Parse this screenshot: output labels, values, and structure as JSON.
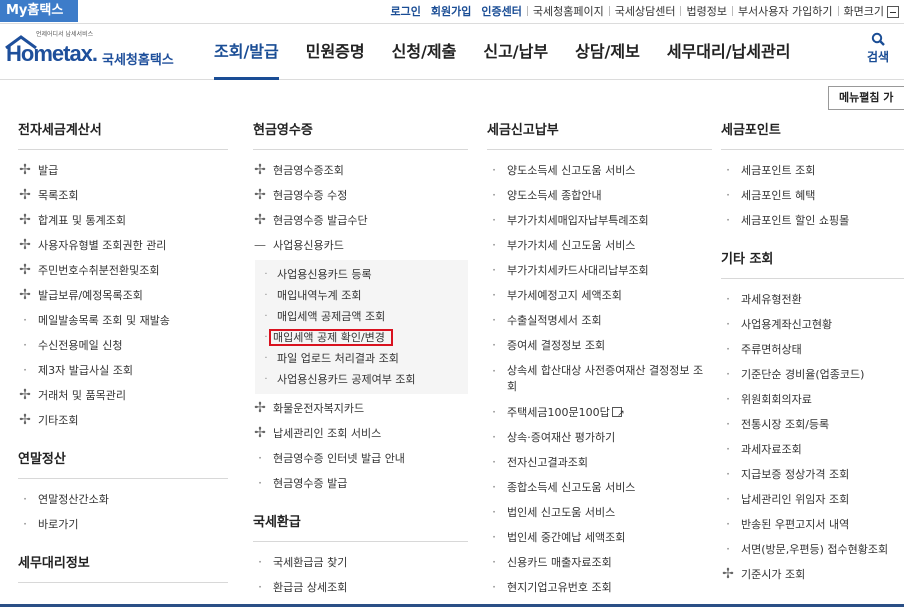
{
  "topbar": {
    "brand": "My홈택스",
    "links": [
      {
        "label": "로그인",
        "strong": true
      },
      {
        "label": "회원가입",
        "strong": true
      },
      {
        "label": "인증센터",
        "strong": true
      },
      {
        "label": "국세청홈페이지",
        "strong": false
      },
      {
        "label": "국세상담센터",
        "strong": false
      },
      {
        "label": "법령정보",
        "strong": false
      },
      {
        "label": "부서사용자 가입하기",
        "strong": false
      },
      {
        "label": "화면크기",
        "strong": false
      }
    ]
  },
  "header": {
    "logo_tagline": "언제어디서 납세서비스",
    "logo_text": "Hometax.",
    "logo_kor": "국세청홈택스",
    "nav": [
      {
        "label": "조회/발급",
        "active": true
      },
      {
        "label": "민원증명",
        "active": false
      },
      {
        "label": "신청/제출",
        "active": false
      },
      {
        "label": "신고/납부",
        "active": false
      },
      {
        "label": "상담/제보",
        "active": false
      },
      {
        "label": "세무대리/납세관리",
        "active": false
      }
    ],
    "search_label": "검색"
  },
  "menu_toggle_label": "메뉴펼침 가",
  "col1": {
    "title": "전자세금계산서",
    "items": [
      {
        "label": "발급",
        "marker": "plus"
      },
      {
        "label": "목록조회",
        "marker": "plus"
      },
      {
        "label": "합계표 및 통계조회",
        "marker": "plus"
      },
      {
        "label": "사용자유형별 조회권한 관리",
        "marker": "plus"
      },
      {
        "label": "주민번호수취분전환및조회",
        "marker": "plus"
      },
      {
        "label": "발급보류/예정목록조회",
        "marker": "plus"
      },
      {
        "label": "메일발송목록 조회 및 재발송",
        "marker": "dot"
      },
      {
        "label": "수신전용메일 신청",
        "marker": "dot"
      },
      {
        "label": "제3자 발급사실 조회",
        "marker": "dot"
      },
      {
        "label": "거래처 및 품목관리",
        "marker": "plus"
      },
      {
        "label": "기타조회",
        "marker": "plus"
      }
    ],
    "title2": "연말정산",
    "items2": [
      {
        "label": "연말정산간소화",
        "marker": "dot"
      },
      {
        "label": "바로가기",
        "marker": "dot"
      }
    ],
    "title3": "세무대리정보"
  },
  "col2": {
    "title": "현금영수증",
    "items_top": [
      {
        "label": "현금영수증조회",
        "marker": "plus"
      },
      {
        "label": "현금영수증 수정",
        "marker": "plus"
      },
      {
        "label": "현금영수증 발급수단",
        "marker": "plus"
      },
      {
        "label": "사업용신용카드",
        "marker": "minus"
      }
    ],
    "subitems": [
      {
        "label": "사업용신용카드 등록",
        "highlight": false
      },
      {
        "label": "매입내역누계 조회",
        "highlight": false
      },
      {
        "label": "매입세액 공제금액 조회",
        "highlight": false
      },
      {
        "label": "매입세액 공제 확인/변경",
        "highlight": true
      },
      {
        "label": "파일 업로드 처리결과 조회",
        "highlight": false
      },
      {
        "label": "사업용신용카드 공제여부 조회",
        "highlight": false
      }
    ],
    "items_bottom": [
      {
        "label": "화물운전자복지카드",
        "marker": "plus"
      },
      {
        "label": "납세관리인 조회 서비스",
        "marker": "plus"
      },
      {
        "label": "현금영수증 인터넷 발급 안내",
        "marker": "dot"
      },
      {
        "label": "현금영수증 발급",
        "marker": "dot"
      }
    ],
    "title2": "국세환급",
    "items2": [
      {
        "label": "국세환급금 찾기",
        "marker": "dot"
      },
      {
        "label": "환급금 상세조회",
        "marker": "dot"
      }
    ]
  },
  "col3": {
    "title": "세금신고납부",
    "items": [
      {
        "label": "양도소득세 신고도움 서비스",
        "tall": false
      },
      {
        "label": "양도소득세 종합안내",
        "tall": false
      },
      {
        "label": "부가가치세매입자납부특례조회",
        "tall": false
      },
      {
        "label": "부가가치세 신고도움 서비스",
        "tall": false
      },
      {
        "label": "부가가치세카드사대리납부조회",
        "tall": false
      },
      {
        "label": "부가세예정고지 세액조회",
        "tall": false
      },
      {
        "label": "수출실적명세서 조회",
        "tall": false
      },
      {
        "label": "증여세 결정정보 조회",
        "tall": false
      },
      {
        "label": "상속세 합산대상 사전증여재산 결정정보 조회",
        "tall": true
      },
      {
        "label": "주택세금100문100답",
        "tall": false,
        "ext": true
      },
      {
        "label": "상속·증여재산 평가하기",
        "tall": false
      },
      {
        "label": "전자신고결과조회",
        "tall": false
      },
      {
        "label": "종합소득세 신고도움 서비스",
        "tall": false
      },
      {
        "label": "법인세 신고도움 서비스",
        "tall": false
      },
      {
        "label": "법인세 중간예납 세액조회",
        "tall": false
      },
      {
        "label": "신용카드 매출자료조회",
        "tall": false
      },
      {
        "label": "현지기업고유번호 조회",
        "tall": false
      }
    ]
  },
  "col4": {
    "title": "세금포인트",
    "items": [
      {
        "label": "세금포인트 조회",
        "marker": "dot"
      },
      {
        "label": "세금포인트 혜택",
        "marker": "dot"
      },
      {
        "label": "세금포인트 할인 쇼핑몰",
        "marker": "dot"
      }
    ],
    "title2": "기타 조회",
    "items2": [
      {
        "label": "과세유형전환",
        "marker": "dot"
      },
      {
        "label": "사업용계좌신고현황",
        "marker": "dot"
      },
      {
        "label": "주류면허상태",
        "marker": "dot"
      },
      {
        "label": "기준단순 경비율(업종코드)",
        "marker": "dot"
      },
      {
        "label": "위원회회의자료",
        "marker": "dot"
      },
      {
        "label": "전통시장 조회/등록",
        "marker": "dot"
      },
      {
        "label": "과세자료조회",
        "marker": "dot"
      },
      {
        "label": "지급보증 정상가격 조회",
        "marker": "dot"
      },
      {
        "label": "납세관리인 위임자 조회",
        "marker": "dot"
      },
      {
        "label": "반송된 우편고지서 내역",
        "marker": "dot"
      },
      {
        "label": "서면(방문,우편등) 접수현황조회",
        "marker": "dot"
      },
      {
        "label": "기준시가 조회",
        "marker": "plus"
      }
    ]
  }
}
